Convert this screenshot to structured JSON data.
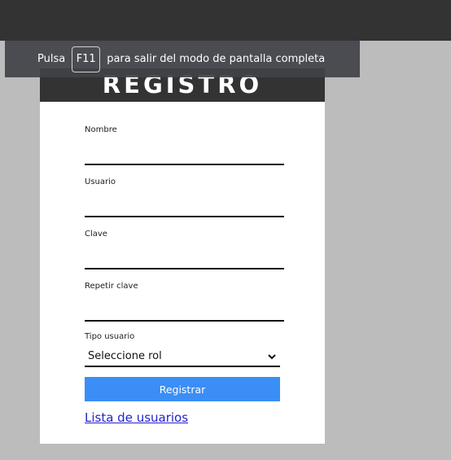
{
  "toast": {
    "prefix": "Pulsa",
    "key": "F11",
    "suffix": "para salir del modo de pantalla completa"
  },
  "form": {
    "title": "REGISTRO",
    "fields": [
      {
        "label": "Nombre",
        "value": ""
      },
      {
        "label": "Usuario",
        "value": ""
      },
      {
        "label": "Clave",
        "value": ""
      },
      {
        "label": "Repetir clave",
        "value": ""
      }
    ],
    "role": {
      "label": "Tipo usuario",
      "selected": "Seleccione rol"
    },
    "submit_label": "Registrar",
    "list_link": "Lista de usuarios"
  },
  "colors": {
    "header_bg": "#333333",
    "button_bg": "#3a8ef6",
    "page_bg": "#bcbcbc"
  }
}
